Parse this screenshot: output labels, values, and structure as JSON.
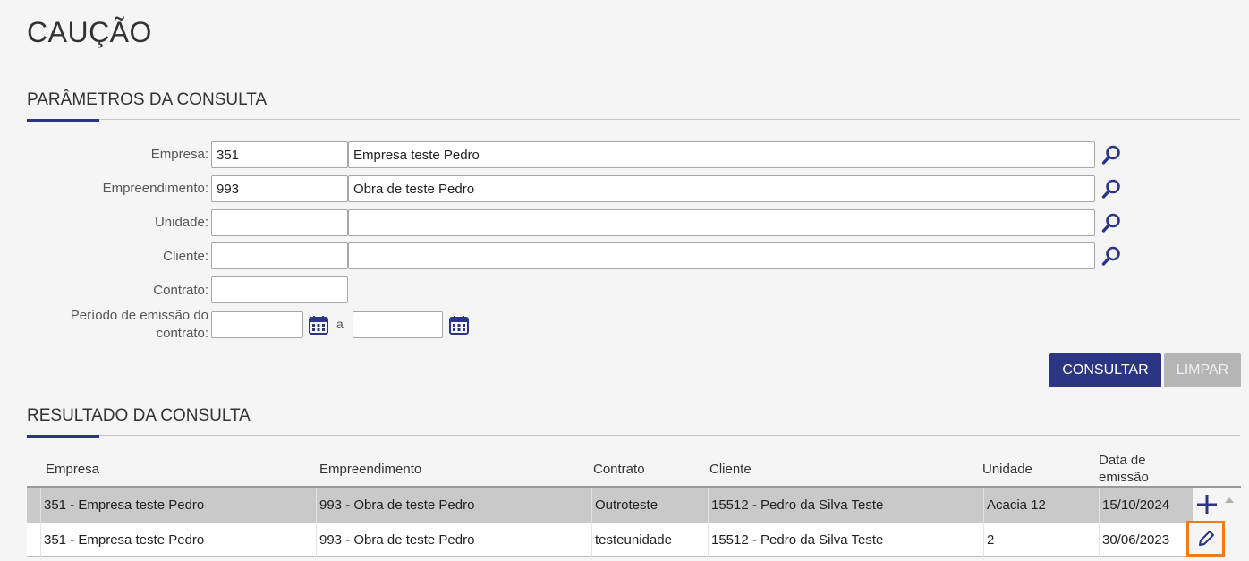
{
  "page": {
    "title": "CAUÇÃO"
  },
  "params": {
    "heading": "PARÂMETROS DA CONSULTA",
    "empresa": {
      "label": "Empresa:",
      "code": "351",
      "name": "Empresa teste Pedro"
    },
    "empreendimento": {
      "label": "Empreendimento:",
      "code": "993",
      "name": "Obra de teste Pedro"
    },
    "unidade": {
      "label": "Unidade:",
      "code": "",
      "name": ""
    },
    "cliente": {
      "label": "Cliente:",
      "code": "",
      "name": ""
    },
    "contrato": {
      "label": "Contrato:",
      "value": ""
    },
    "periodo": {
      "label_line1": "Período de emissão do",
      "label_line2": "contrato:",
      "from": "",
      "separator": "a",
      "to": ""
    }
  },
  "actions": {
    "consultar": "CONSULTAR",
    "limpar": "LIMPAR"
  },
  "result": {
    "heading": "RESULTADO DA CONSULTA",
    "columns": {
      "empresa": "Empresa",
      "empreendimento": "Empreendimento",
      "contrato": "Contrato",
      "cliente": "Cliente",
      "unidade": "Unidade",
      "data_line1": "Data de",
      "data_line2": "emissão"
    },
    "rows": [
      {
        "empresa": "351 - Empresa teste Pedro",
        "empreendimento": "993 - Obra de teste Pedro",
        "contrato": "Outroteste",
        "cliente": "15512 - Pedro da Silva Teste",
        "unidade": "Acacia 12",
        "data": "15/10/2024"
      },
      {
        "empresa": "351 - Empresa teste Pedro",
        "empreendimento": "993 - Obra de teste Pedro",
        "contrato": "testeunidade",
        "cliente": "15512 - Pedro da Silva Teste",
        "unidade": "2",
        "data": "30/06/2023"
      }
    ]
  },
  "colors": {
    "primary": "#2b3584",
    "highlight": "#f07b12",
    "disabled": "#b5b5b5",
    "selected_row": "#c9c9c9"
  },
  "icons": {
    "search": "search-icon",
    "calendar": "calendar-icon",
    "add": "plus-icon",
    "edit": "pencil-icon",
    "scroll": "scroll-up-icon"
  }
}
